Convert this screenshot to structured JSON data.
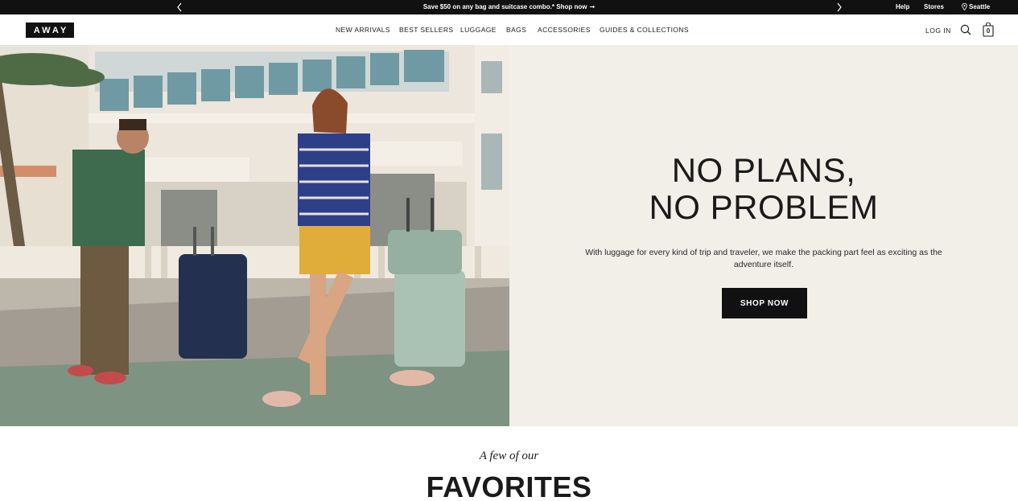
{
  "announcement": {
    "prev_label": "‹",
    "next_label": "›",
    "promo_text": "Save $50 on any bag and suitcase combo.* Shop now",
    "promo_arrow": "→",
    "help": "Help",
    "stores": "Stores",
    "location": "Seattle",
    "location_icon": "map-pin-icon"
  },
  "header": {
    "logo": "AWAY",
    "nav": [
      {
        "label": "NEW ARRIVALS"
      },
      {
        "label": "BEST SELLERS"
      },
      {
        "label": "LUGGAGE"
      },
      {
        "label": "BAGS"
      },
      {
        "label": "ACCESSORIES"
      },
      {
        "label": "GUIDES & COLLECTIONS"
      }
    ],
    "login": "LOG IN",
    "search_icon": "search-icon",
    "cart_icon": "shopping-bag-icon",
    "cart_count": "0"
  },
  "hero": {
    "title_line1": "NO PLANS,",
    "title_line2": "NO PROBLEM",
    "subtitle": "With luggage for every kind of trip and traveler, we make the packing part feel as exciting as the adventure itself.",
    "cta": "SHOP NOW",
    "panel_color": "#f2eee8"
  },
  "favorites": {
    "kicker": "A few of our",
    "title": "FAVORITES"
  },
  "colors": {
    "announcement_bg": "#111111",
    "accent": "#111111",
    "panel": "#f2eee8"
  }
}
